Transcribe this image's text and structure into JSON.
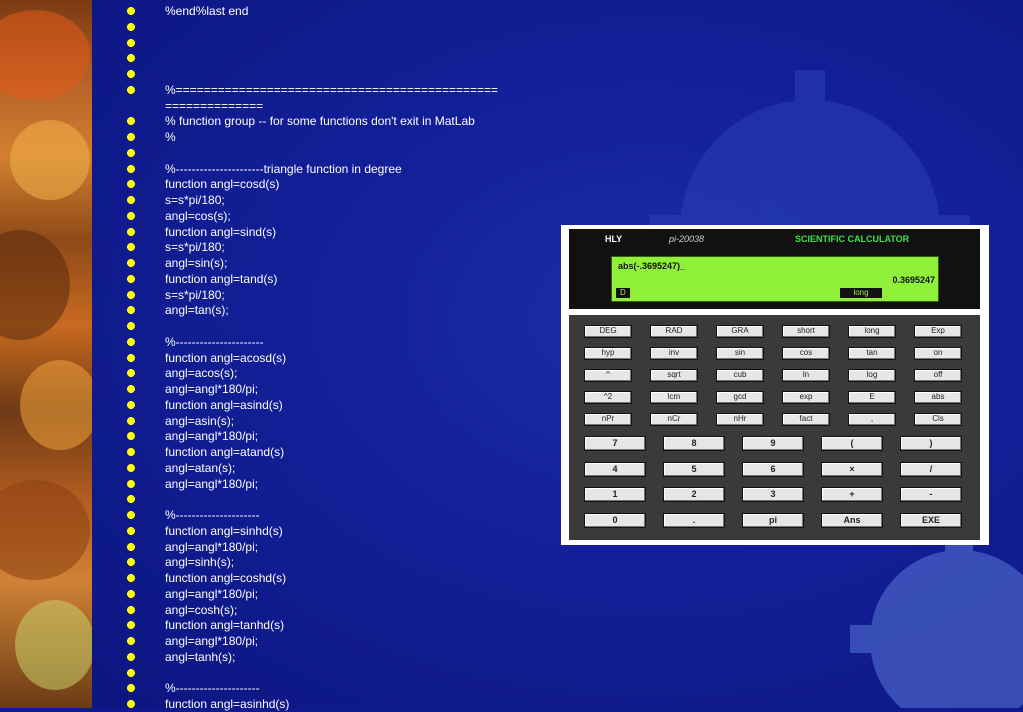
{
  "code_lines": [
    "%end%last end",
    "",
    "",
    "",
    "",
    "%==============================================",
    "==============",
    "%  function group  -- for some functions don't exit in MatLab",
    "%",
    "",
    "%----------------------triangle function in degree",
    "function angl=cosd(s)",
    "s=s*pi/180;",
    "angl=cos(s);",
    "function angl=sind(s)",
    "s=s*pi/180;",
    "angl=sin(s);",
    "function angl=tand(s)",
    "s=s*pi/180;",
    "angl=tan(s);",
    "",
    "%----------------------",
    "function angl=acosd(s)",
    "angl=acos(s);",
    "angl=angl*180/pi;",
    "function angl=asind(s)",
    "angl=asin(s);",
    "angl=angl*180/pi;",
    "function angl=atand(s)",
    "angl=atan(s);",
    "angl=angl*180/pi;",
    "",
    "%---------------------",
    "function angl=sinhd(s)",
    "angl=angl*180/pi;",
    "angl=sinh(s);",
    "function angl=coshd(s)",
    "angl=angl*180/pi;",
    "angl=cosh(s);",
    "function angl=tanhd(s)",
    "angl=angl*180/pi;",
    "angl=tanh(s);",
    "",
    "%---------------------",
    "function angl=asinhd(s)"
  ],
  "calculator": {
    "brand": "HLY",
    "version": "pi-20038",
    "title": "SCIENTIFIC CALCULATOR",
    "display_input": "abs(-.3695247)_",
    "display_result": "0.3695247",
    "angle_mode": "D",
    "precision_mode": "long",
    "function_rows": [
      [
        "DEG",
        "RAD",
        "GRA",
        "short",
        "long",
        "Exp"
      ],
      [
        "hyp",
        "inv",
        "sin",
        "cos",
        "tan",
        "on"
      ],
      [
        "^",
        "sqrt",
        "cub",
        "ln",
        "log",
        "off"
      ],
      [
        "^2",
        "lcm",
        "gcd",
        "exp",
        "E",
        "abs"
      ],
      [
        "nPr",
        "nCr",
        "nHr",
        "fact",
        ",",
        "Cls"
      ]
    ],
    "number_rows": [
      [
        "7",
        "8",
        "9",
        "(",
        ")"
      ],
      [
        "4",
        "5",
        "6",
        "×",
        "/"
      ],
      [
        "1",
        "2",
        "3",
        "+",
        "-"
      ],
      [
        "0",
        ".",
        "pi",
        "Ans",
        "EXE"
      ]
    ]
  },
  "colors": {
    "background": "#0f1a8c",
    "text": "#ffffff",
    "bullet": "#ffff00",
    "calc_display": "#8ff03a",
    "calc_title": "#3fe04a"
  }
}
